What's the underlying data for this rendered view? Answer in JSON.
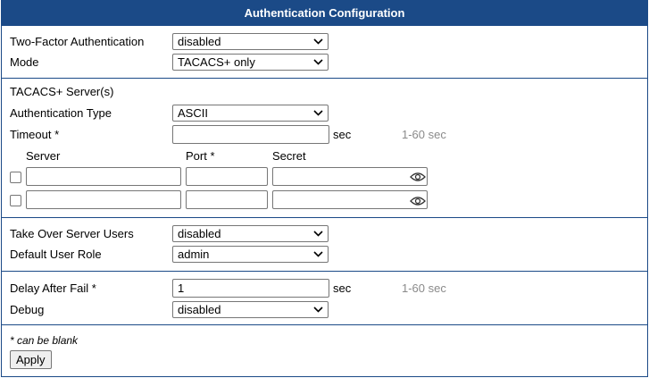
{
  "title": "Authentication Configuration",
  "two_factor": {
    "label": "Two-Factor Authentication",
    "value": "disabled"
  },
  "mode": {
    "label": "Mode",
    "value": "TACACS+ only"
  },
  "tacacs": {
    "section_label": "TACACS+ Server(s)",
    "auth_type": {
      "label": "Authentication Type",
      "value": "ASCII"
    },
    "timeout": {
      "label": "Timeout *",
      "value": "",
      "unit": "sec",
      "range": "1-60 sec"
    },
    "columns": {
      "server": "Server",
      "port": "Port *",
      "secret": "Secret"
    },
    "servers": [
      {
        "checked": false,
        "server": "",
        "port": "",
        "secret": ""
      },
      {
        "checked": false,
        "server": "",
        "port": "",
        "secret": ""
      }
    ]
  },
  "take_over": {
    "label": "Take Over Server Users",
    "value": "disabled"
  },
  "default_role": {
    "label": "Default User Role",
    "value": "admin"
  },
  "delay": {
    "label": "Delay After Fail *",
    "value": "1",
    "unit": "sec",
    "range": "1-60 sec"
  },
  "debug": {
    "label": "Debug",
    "value": "disabled"
  },
  "note": "* can be blank",
  "apply_label": "Apply",
  "colors": {
    "header": "#1b4a87",
    "hint": "#8a8a8a"
  }
}
